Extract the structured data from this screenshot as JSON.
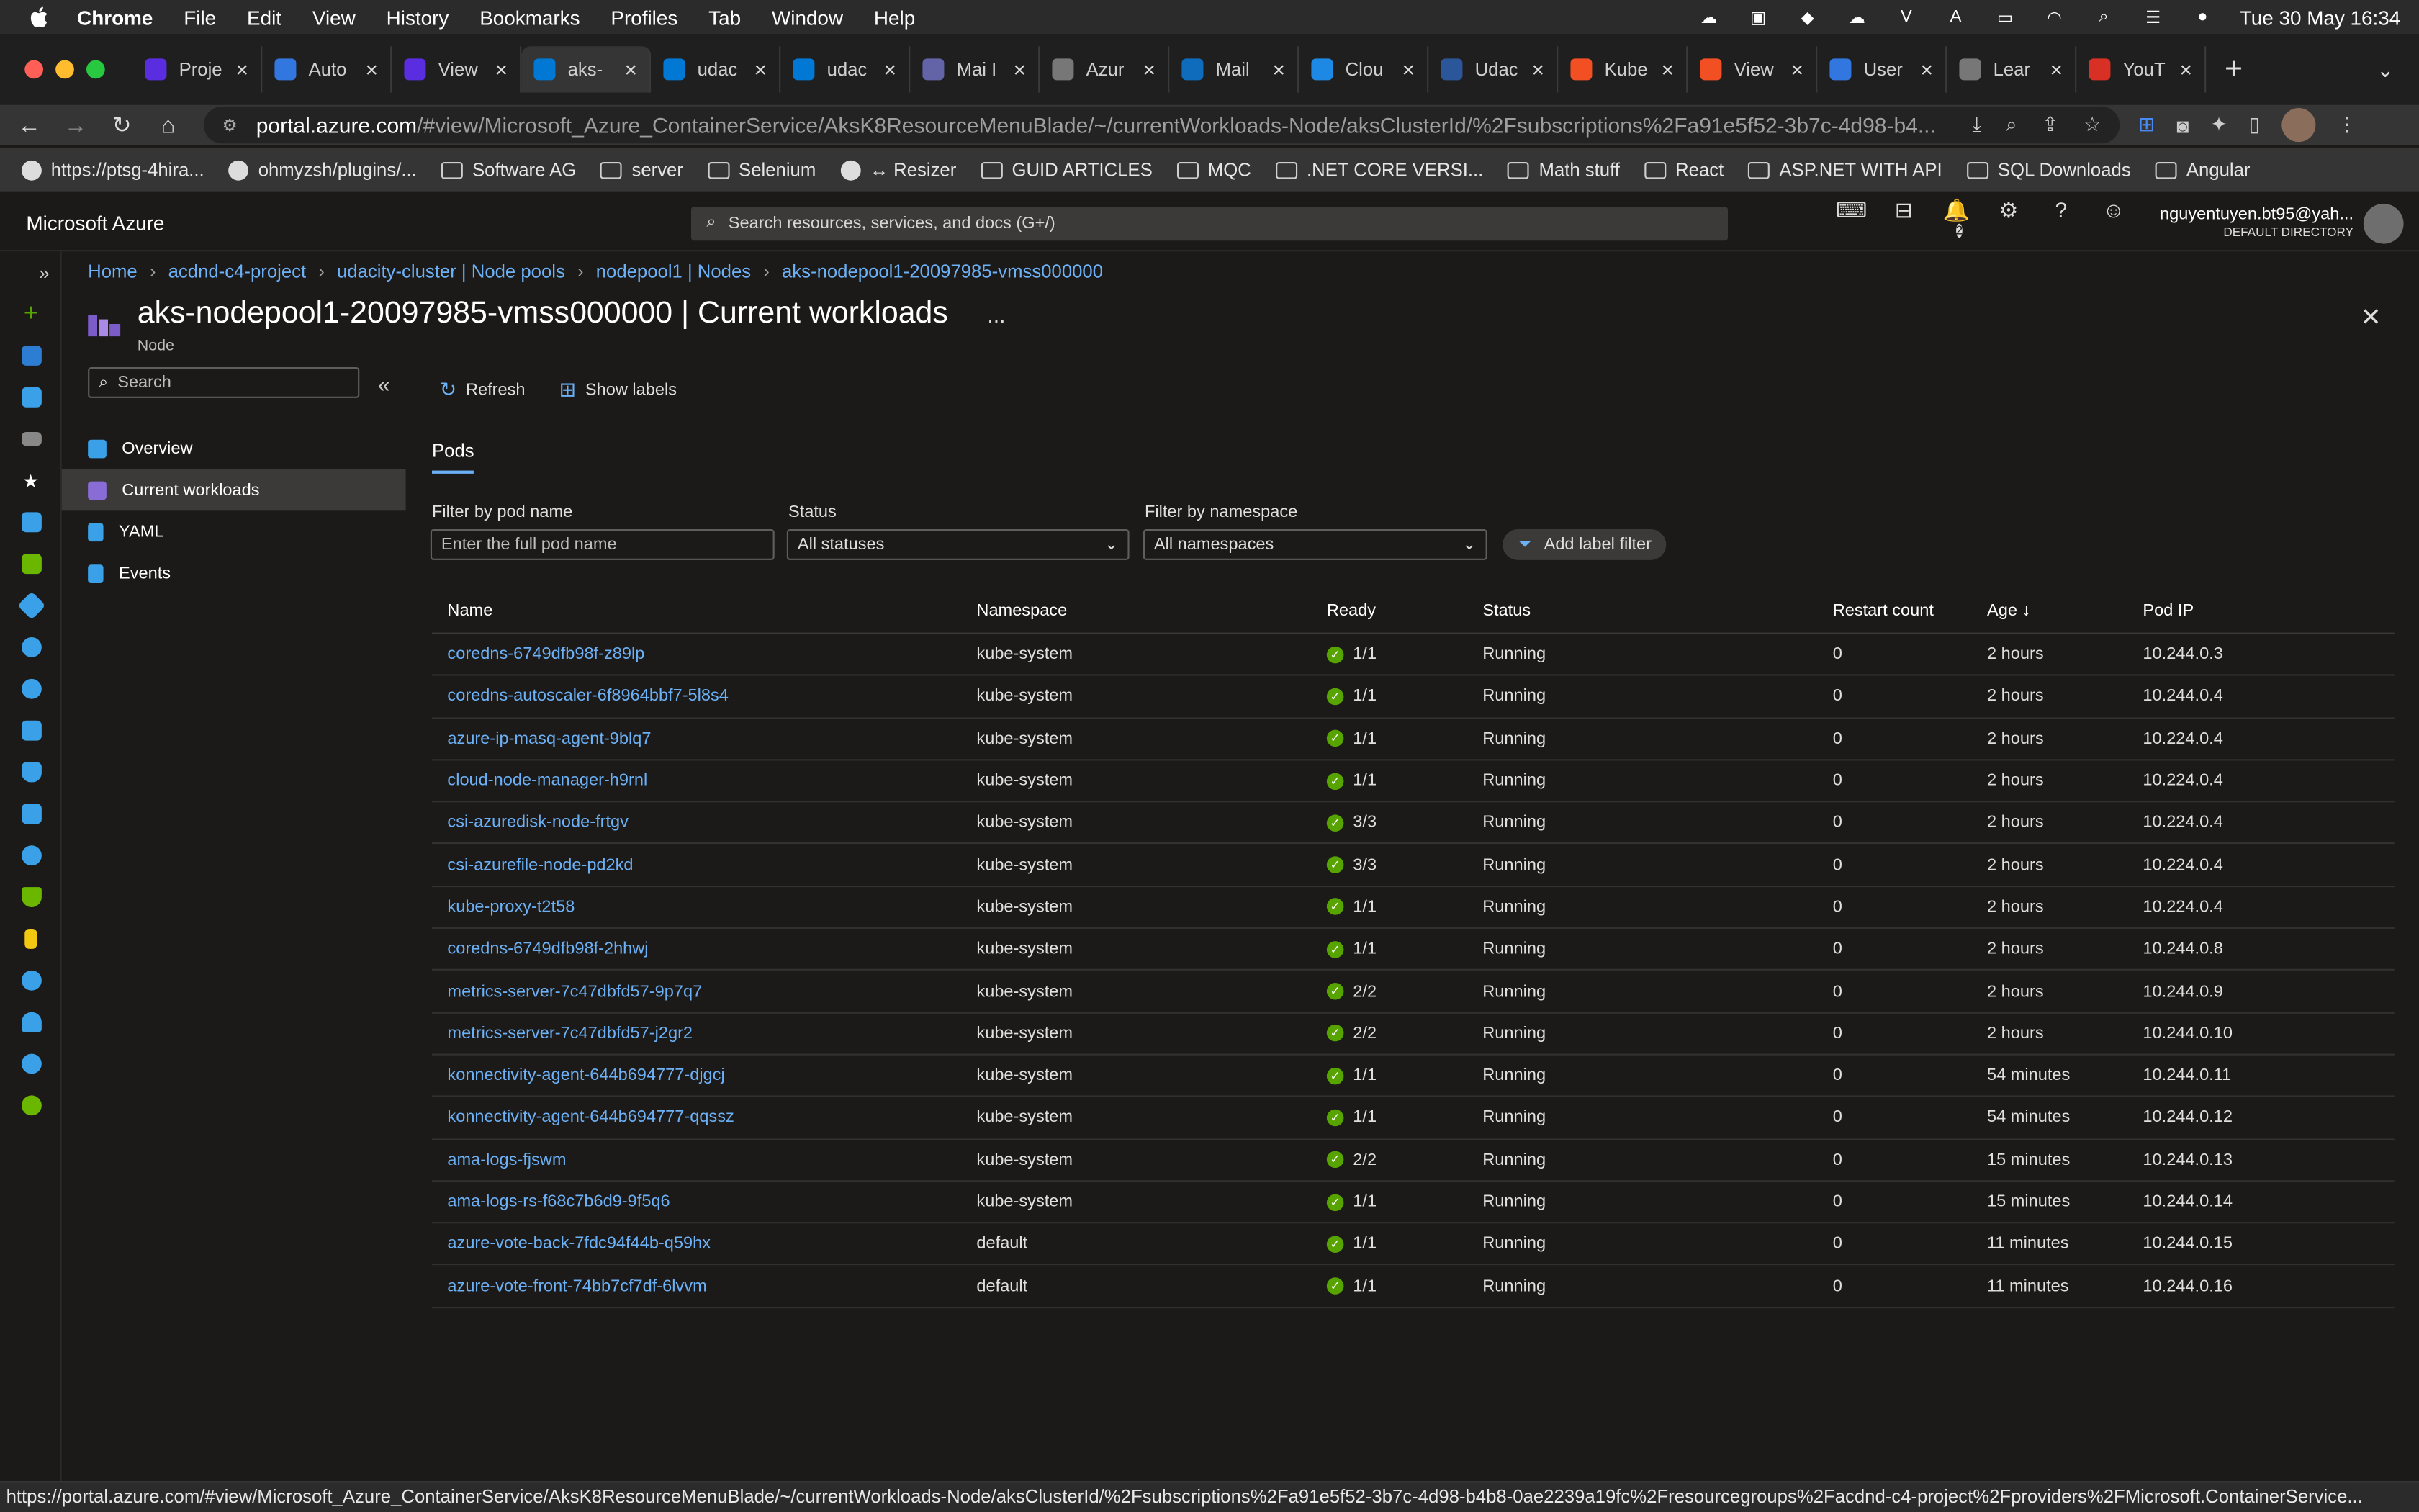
{
  "menubar": {
    "app": "Chrome",
    "items": [
      "File",
      "Edit",
      "View",
      "History",
      "Bookmarks",
      "Profiles",
      "Tab",
      "Window",
      "Help"
    ],
    "clock": "Tue 30 May  16:34"
  },
  "tabs": [
    {
      "label": "Proje",
      "color": "#5b2de0"
    },
    {
      "label": "Auto",
      "color": "#3277e0"
    },
    {
      "label": "View",
      "color": "#5b2de0"
    },
    {
      "label": "aks-",
      "color": "#0078d4"
    },
    {
      "label": "udac",
      "color": "#0078d4"
    },
    {
      "label": "udac",
      "color": "#0078d4"
    },
    {
      "label": "Mai I",
      "color": "#6264a7"
    },
    {
      "label": "Azur",
      "color": "#777777"
    },
    {
      "label": "Mail",
      "color": "#0f6cbd"
    },
    {
      "label": "Clou",
      "color": "#1e88e5"
    },
    {
      "label": "Udac",
      "color": "#2b579a"
    },
    {
      "label": "Kube",
      "color": "#f25022"
    },
    {
      "label": "View",
      "color": "#f25022"
    },
    {
      "label": "User",
      "color": "#3277e0"
    },
    {
      "label": "Lear",
      "color": "#777777"
    },
    {
      "label": "YouT",
      "color": "#d93025"
    }
  ],
  "address": {
    "host": "portal.azure.com",
    "path": "/#view/Microsoft_Azure_ContainerService/AksK8ResourceMenuBlade/~/currentWorkloads-Node/aksClusterId/%2Fsubscriptions%2Fa91e5f52-3b7c-4d98-b4..."
  },
  "bookmarks": [
    "https://ptsg-4hira...",
    "ohmyzsh/plugins/...",
    "Software AG",
    "server",
    "Selenium",
    "↔ Resizer",
    "GUID ARTICLES",
    "MQC",
    ".NET CORE VERSI...",
    "Math stuff",
    "React",
    "ASP.NET WITH API",
    "SQL Downloads",
    "Angular"
  ],
  "azure": {
    "brand": "Microsoft Azure",
    "search_placeholder": "Search resources, services, and docs (G+/)",
    "notifications": "2",
    "user": "nguyentuyen.bt95@yah...",
    "directory": "DEFAULT DIRECTORY"
  },
  "breadcrumb": [
    "Home",
    "acdnd-c4-project",
    "udacity-cluster | Node pools",
    "nodepool1 | Nodes",
    "aks-nodepool1-20097985-vmss000000"
  ],
  "page": {
    "title": "aks-nodepool1-20097985-vmss000000 | Current workloads",
    "subtitle": "Node",
    "more": "...",
    "close": "✕"
  },
  "resnav": {
    "search_placeholder": "Search",
    "items": [
      "Overview",
      "Current workloads",
      "YAML",
      "Events"
    ]
  },
  "toolbar": {
    "refresh": "Refresh",
    "show_labels": "Show labels"
  },
  "pivot": "Pods",
  "filters": {
    "pod_label": "Filter by pod name",
    "pod_placeholder": "Enter the full pod name",
    "status_label": "Status",
    "status_value": "All statuses",
    "ns_label": "Filter by namespace",
    "ns_value": "All namespaces",
    "add_label": "Add label filter"
  },
  "columns": [
    "Name",
    "Namespace",
    "Ready",
    "Status",
    "Restart count",
    "Age ↓",
    "Pod IP"
  ],
  "pods": [
    [
      "coredns-6749dfb98f-z89lp",
      "kube-system",
      "1/1",
      "Running",
      "0",
      "2 hours",
      "10.244.0.3"
    ],
    [
      "coredns-autoscaler-6f8964bbf7-5l8s4",
      "kube-system",
      "1/1",
      "Running",
      "0",
      "2 hours",
      "10.244.0.4"
    ],
    [
      "azure-ip-masq-agent-9blq7",
      "kube-system",
      "1/1",
      "Running",
      "0",
      "2 hours",
      "10.224.0.4"
    ],
    [
      "cloud-node-manager-h9rnl",
      "kube-system",
      "1/1",
      "Running",
      "0",
      "2 hours",
      "10.224.0.4"
    ],
    [
      "csi-azuredisk-node-frtgv",
      "kube-system",
      "3/3",
      "Running",
      "0",
      "2 hours",
      "10.224.0.4"
    ],
    [
      "csi-azurefile-node-pd2kd",
      "kube-system",
      "3/3",
      "Running",
      "0",
      "2 hours",
      "10.224.0.4"
    ],
    [
      "kube-proxy-t2t58",
      "kube-system",
      "1/1",
      "Running",
      "0",
      "2 hours",
      "10.224.0.4"
    ],
    [
      "coredns-6749dfb98f-2hhwj",
      "kube-system",
      "1/1",
      "Running",
      "0",
      "2 hours",
      "10.244.0.8"
    ],
    [
      "metrics-server-7c47dbfd57-9p7q7",
      "kube-system",
      "2/2",
      "Running",
      "0",
      "2 hours",
      "10.244.0.9"
    ],
    [
      "metrics-server-7c47dbfd57-j2gr2",
      "kube-system",
      "2/2",
      "Running",
      "0",
      "2 hours",
      "10.244.0.10"
    ],
    [
      "konnectivity-agent-644b694777-djgcj",
      "kube-system",
      "1/1",
      "Running",
      "0",
      "54 minutes",
      "10.244.0.11"
    ],
    [
      "konnectivity-agent-644b694777-qqssz",
      "kube-system",
      "1/1",
      "Running",
      "0",
      "54 minutes",
      "10.244.0.12"
    ],
    [
      "ama-logs-fjswm",
      "kube-system",
      "2/2",
      "Running",
      "0",
      "15 minutes",
      "10.244.0.13"
    ],
    [
      "ama-logs-rs-f68c7b6d9-9f5q6",
      "kube-system",
      "1/1",
      "Running",
      "0",
      "15 minutes",
      "10.244.0.14"
    ],
    [
      "azure-vote-back-7fdc94f44b-q59hx",
      "default",
      "1/1",
      "Running",
      "0",
      "11 minutes",
      "10.244.0.15"
    ],
    [
      "azure-vote-front-74bb7cf7df-6lvvm",
      "default",
      "1/1",
      "Running",
      "0",
      "11 minutes",
      "10.244.0.16"
    ]
  ],
  "statusbar": "https://portal.azure.com/#view/Microsoft_Azure_ContainerService/AksK8ResourceMenuBlade/~/currentWorkloads-Node/aksClusterId/%2Fsubscriptions%2Fa91e5f52-3b7c-4d98-b4b8-0ae2239a19fc%2Fresourcegroups%2Facdnd-c4-project%2Fproviders%2FMicrosoft.ContainerService..."
}
